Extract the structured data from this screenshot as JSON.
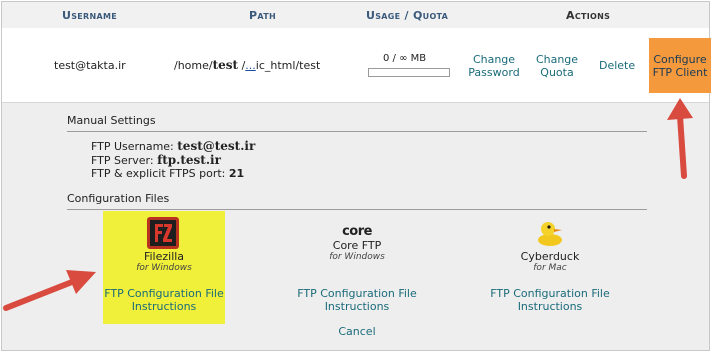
{
  "header": {
    "username": "Username",
    "path": "Path",
    "usage_quota": "Usage / Quota",
    "actions": "Actions"
  },
  "account": {
    "username": "test@takta.ir",
    "path_prefix": "/home/",
    "path_user": "test",
    "path_sep": " /",
    "path_ellipsis": "...",
    "path_suffix": "ic_html/test",
    "usage": "0 / ∞ MB",
    "change_password": "Change Password",
    "change_quota": "Change Quota",
    "delete": "Delete",
    "configure_ftp_client": "Configure FTP Client"
  },
  "manual_settings": {
    "title": "Manual Settings",
    "ftp_username_label": "FTP Username:",
    "ftp_username_value": "test@test.ir",
    "ftp_server_label": "FTP Server:",
    "ftp_server_value": "ftp.test.ir",
    "ftp_port_label": "FTP & explicit FTPS port:",
    "ftp_port_value": "21"
  },
  "configuration_files": {
    "title": "Configuration Files",
    "clients": [
      {
        "name": "Filezilla",
        "platform": "for Windows",
        "instructions": "FTP Configuration File Instructions"
      },
      {
        "logo_text": "core",
        "name": "Core FTP",
        "platform": "for Windows",
        "instructions": "FTP Configuration File Instructions"
      },
      {
        "name": "Cyberduck",
        "platform": "for Mac",
        "instructions": "FTP Configuration File Instructions"
      }
    ],
    "cancel": "Cancel"
  },
  "colors": {
    "accent_orange": "#f59a3c",
    "highlight_yellow": "#f0ef3a",
    "arrow_red": "#d94a3f",
    "link": "#1a6b7a",
    "header_text": "#3a5a7c"
  }
}
